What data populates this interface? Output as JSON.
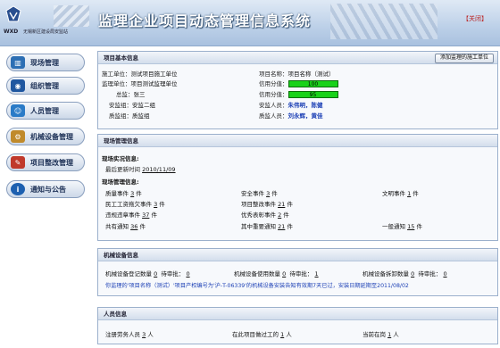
{
  "header": {
    "logo_text": "WXD",
    "org_name": "无锡新区建设局安监站",
    "title": "监理企业项目动态管理信息系统",
    "close": "【关闭】"
  },
  "nav": [
    {
      "label": "现场管理",
      "icon": "building-icon",
      "color": "#2d6fb4"
    },
    {
      "label": "组织管理",
      "icon": "org-chart-icon",
      "color": "#1f57a0"
    },
    {
      "label": "人员管理",
      "icon": "people-icon",
      "color": "#2a7bc7"
    },
    {
      "label": "机械设备管理",
      "icon": "machine-icon",
      "color": "#c08a2b"
    },
    {
      "label": "项目整改管理",
      "icon": "rectify-icon",
      "color": "#c0392b"
    },
    {
      "label": "通知与公告",
      "icon": "info-icon",
      "color": "#1d60b0"
    }
  ],
  "project_info": {
    "heading": "项目基本信息",
    "add_button": "添加监理的施工单位",
    "construction_unit_label": "施工单位：",
    "construction_unit": "测试项目施工单位",
    "project_name_label": "项目名称：",
    "project_name": "项目名称（测试）",
    "supervision_unit_label": "监理单位：",
    "supervision_unit": "项目测试监理单位",
    "credit_label_1": "信用分值：",
    "credit_1": "100",
    "chief_label": "总监：",
    "chief": "张三",
    "credit_label_2": "信用分值：",
    "credit_2": "95",
    "safety_group_label": "安监组：",
    "safety_group": "安监二组",
    "safety_staff_label": "安监人员：",
    "safety_staff": "朱伟明，陈健",
    "quality_group_label": "质监组：",
    "quality_group": "质监组",
    "quality_staff_label": "质监人员：",
    "quality_staff": "刘永辉，黄佳"
  },
  "site_mgmt": {
    "heading": "现场管理信息",
    "inspection_title": "现场实况信息:",
    "last_update_label": "最后更新时间",
    "last_update": "2010/11/09",
    "mgmt_title": "现场管理信息:",
    "items": [
      {
        "label": "质量事件",
        "value": "3",
        "unit": "件"
      },
      {
        "label": "安全事件",
        "value": "3",
        "unit": "件"
      },
      {
        "label": "文明事件",
        "value": "1",
        "unit": "件"
      },
      {
        "label": "民工工资拖欠事件",
        "value": "3",
        "unit": "件"
      },
      {
        "label": "项目整改事件",
        "value": "21",
        "unit": "件"
      },
      {
        "label": "违规违章事件",
        "value": "37",
        "unit": "件"
      },
      {
        "label": "优秀表彰事件",
        "value": "2",
        "unit": "件"
      },
      {
        "label": "共有通知",
        "value": "36",
        "unit": "件"
      },
      {
        "label": "其中重要通知",
        "value": "21",
        "unit": "件"
      },
      {
        "label": "一般通知",
        "value": "15",
        "unit": "件"
      }
    ]
  },
  "equipment": {
    "heading": "机械设备信息",
    "register_label": "机械设备登记数量",
    "register_value": "0",
    "register_pending_label": "待审批：",
    "register_pending": "0",
    "use_label": "机械设备使用数量",
    "use_value": "0",
    "use_pending_label": "待审批：",
    "use_pending": "1",
    "remove_label": "机械设备拆卸数量",
    "remove_value": "0",
    "remove_pending_label": "待审批：",
    "remove_pending": "0",
    "notice": "你监理的'项目名称（测试）'项目产权编号为'沪-T-06339'的机械设备安装告知有效期7天已过，安装日期延期至",
    "notice_date": "2011/08/02"
  },
  "personnel": {
    "heading": "人员信息",
    "registered_label": "注册劳务人员",
    "registered": "3",
    "working_label": "在此项目做过工的",
    "working": "1",
    "present_label": "当前在岗",
    "present": "1",
    "unit": "人"
  }
}
